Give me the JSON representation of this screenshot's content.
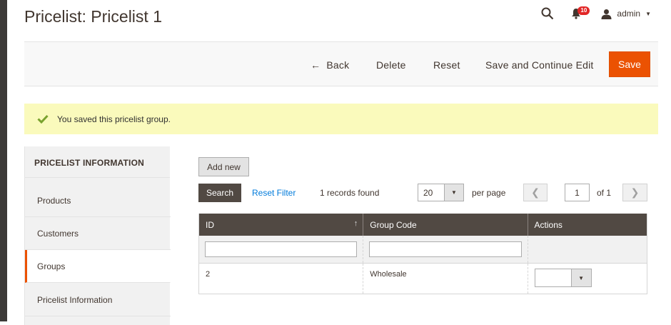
{
  "page": {
    "title": "Pricelist: Pricelist 1"
  },
  "header": {
    "notification_count": "10",
    "user_name": "admin",
    "icons": [
      "search-icon",
      "bell-icon",
      "user-icon",
      "caret-down-icon"
    ]
  },
  "toolbar": {
    "back_label": "Back",
    "delete_label": "Delete",
    "reset_label": "Reset",
    "save_continue_label": "Save and Continue Edit",
    "save_label": "Save"
  },
  "message": {
    "text": "You saved this pricelist group."
  },
  "sidebar": {
    "heading": "PRICELIST INFORMATION",
    "items": [
      {
        "label": "Products"
      },
      {
        "label": "Customers"
      },
      {
        "label": "Groups",
        "active": true
      },
      {
        "label": "Pricelist Information"
      }
    ]
  },
  "grid_controls": {
    "add_new_label": "Add new",
    "search_label": "Search",
    "reset_filter_label": "Reset Filter",
    "records_found": "1 records found",
    "per_page_value": "20",
    "per_page_label": "per page",
    "current_page": "1",
    "of_pages": "of 1"
  },
  "grid": {
    "columns": [
      {
        "label": "ID",
        "sortable": "↑"
      },
      {
        "label": "Group Code"
      },
      {
        "label": "Actions"
      }
    ],
    "rows": [
      {
        "id": "2",
        "group_code": "Wholesale",
        "action": ""
      }
    ]
  },
  "colors": {
    "accent": "#eb5202",
    "header_dark": "#514943",
    "message_bg": "#fafabc",
    "link": "#007bdb"
  }
}
